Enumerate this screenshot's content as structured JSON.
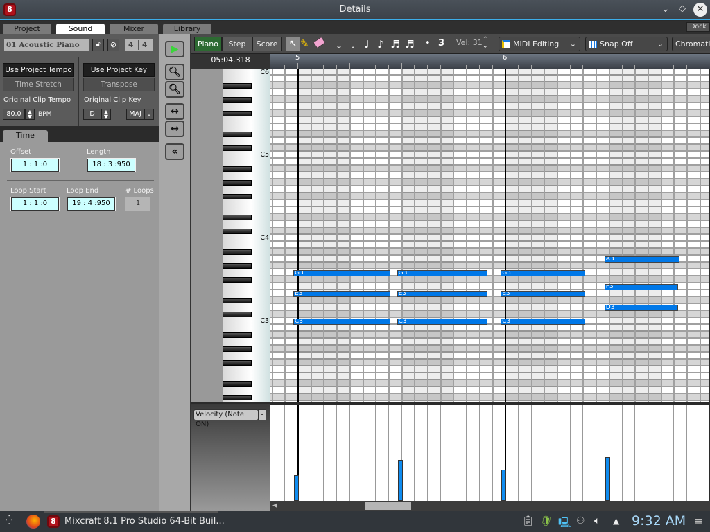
{
  "window": {
    "title": "Details",
    "dock_label": "Dock"
  },
  "tabs": [
    {
      "label": "Project"
    },
    {
      "label": "Sound",
      "active": true
    },
    {
      "label": "Mixer"
    },
    {
      "label": "Library"
    }
  ],
  "track": {
    "name": "01 Acoustic Piano",
    "time_sig_num": "4",
    "time_sig_den": "4"
  },
  "tempo": {
    "use_project_tempo": "Use Project Tempo",
    "time_stretch": "Time Stretch",
    "orig_label": "Original Clip Tempo",
    "value": "80.0",
    "unit": "BPM"
  },
  "key": {
    "use_project_key": "Use Project Key",
    "transpose": "Transpose",
    "orig_label": "Original Clip Key",
    "value": "D",
    "mode": "MAJ"
  },
  "time_tab": {
    "label": "Time",
    "offset_label": "Offset",
    "offset": "1 : 1  :0",
    "length_label": "Length",
    "length": "18 : 3  :950",
    "loop_start_label": "Loop Start",
    "loop_start": "1 : 1  :0",
    "loop_end_label": "Loop End",
    "loop_end": "19 : 4  :950",
    "loops_label": "# Loops",
    "loops": "1"
  },
  "toolbar": {
    "modes": [
      "Piano",
      "Step",
      "Score"
    ],
    "active_mode": "Piano",
    "triplet": "3",
    "dot": "•",
    "velocity_label": "Vel: 31",
    "editing_mode": "MIDI Editing",
    "snap": "Snap Off",
    "scale": "Chromatic"
  },
  "position": "05:04.318",
  "ruler": {
    "bars": [
      "5",
      "6"
    ]
  },
  "keys": {
    "labels": [
      "C6",
      "C5",
      "C4",
      "C3"
    ]
  },
  "notes": [
    {
      "pitch": "G3",
      "start": 0,
      "len": 7.5
    },
    {
      "pitch": "E3",
      "start": 0,
      "len": 7.5
    },
    {
      "pitch": "C3",
      "start": 0,
      "len": 7.5
    },
    {
      "pitch": "G3",
      "start": 8,
      "len": 7.0
    },
    {
      "pitch": "E3",
      "start": 8,
      "len": 7.0
    },
    {
      "pitch": "C3",
      "start": 8,
      "len": 7.0
    },
    {
      "pitch": "G3",
      "start": 16,
      "len": 6.5
    },
    {
      "pitch": "E3",
      "start": 16,
      "len": 6.5
    },
    {
      "pitch": "C3",
      "start": 16,
      "len": 6.5
    },
    {
      "pitch": "A3",
      "start": 24,
      "len": 5.8
    },
    {
      "pitch": "F3",
      "start": 24,
      "len": 5.7
    },
    {
      "pitch": "D3",
      "start": 24,
      "len": 5.7
    }
  ],
  "velocity": {
    "lane_label": "Velocity (Note ON)",
    "values": [
      {
        "start": 0,
        "v": [
          31,
          34
        ]
      },
      {
        "start": 8,
        "v": [
          50,
          54
        ]
      },
      {
        "start": 16,
        "v": [
          41
        ]
      },
      {
        "start": 24,
        "v": [
          58
        ]
      }
    ]
  },
  "taskbar": {
    "app_label": "Mixcraft 8.1 Pro Studio 64-Bit Buil...",
    "clock": "9:32 AM"
  }
}
